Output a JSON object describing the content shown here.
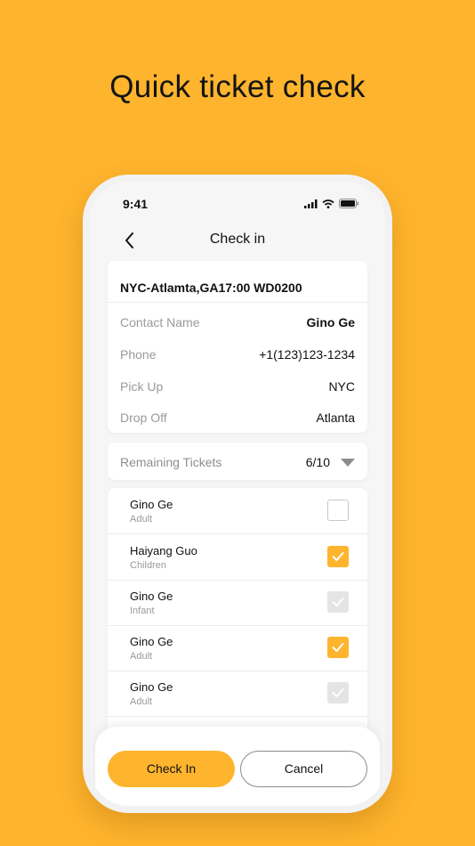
{
  "headline": "Quick ticket check",
  "status_bar": {
    "time": "9:41"
  },
  "nav": {
    "title": "Check in"
  },
  "trip": {
    "title": "NYC-Atlamta,GA17:00 WD0200",
    "rows": [
      {
        "label": "Contact Name",
        "value": "Gino Ge"
      },
      {
        "label": "Phone",
        "value": "+1(123)123-1234"
      },
      {
        "label": "Pick Up",
        "value": "NYC"
      },
      {
        "label": "Drop Off",
        "value": "Atlanta"
      }
    ]
  },
  "remaining": {
    "label": "Remaining Tickets",
    "count": "6/10"
  },
  "passengers": [
    {
      "name": "Gino Ge",
      "type": "Adult",
      "state": "unchecked"
    },
    {
      "name": "Haiyang Guo",
      "type": "Children",
      "state": "checked"
    },
    {
      "name": "Gino Ge",
      "type": "Infant",
      "state": "disabled"
    },
    {
      "name": "Gino Ge",
      "type": "Adult",
      "state": "checked"
    },
    {
      "name": "Gino Ge",
      "type": "Adult",
      "state": "disabled"
    }
  ],
  "buttons": {
    "check_in": "Check In",
    "cancel": "Cancel"
  },
  "colors": {
    "accent": "#FEB42D",
    "disabled": "#E4E4E4"
  }
}
